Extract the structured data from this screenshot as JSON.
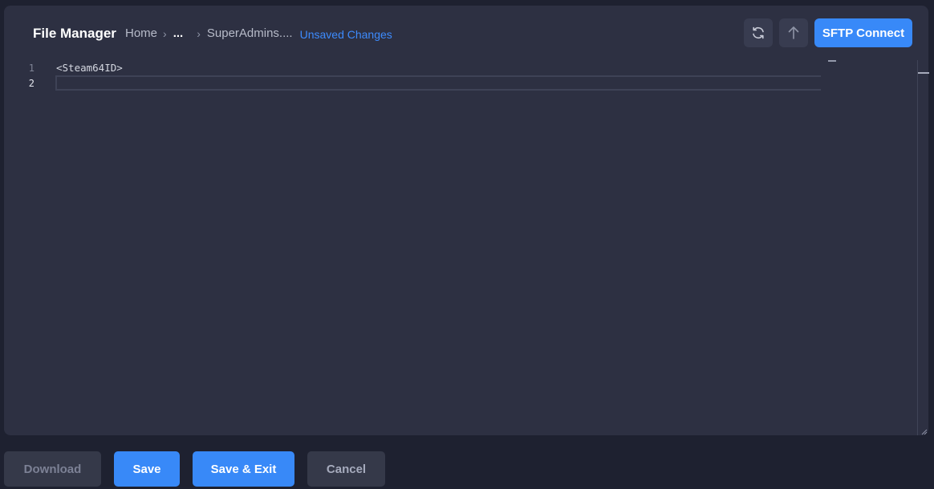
{
  "header": {
    "title": "File Manager",
    "breadcrumb": {
      "home": "Home",
      "ellipsis": "...",
      "file": "SuperAdmins....",
      "status": "Unsaved Changes"
    },
    "refresh_icon": "refresh-icon",
    "upload_icon": "arrow-up-icon",
    "sftp_label": "SFTP Connect"
  },
  "editor": {
    "lines": [
      {
        "number": "1",
        "text": "<Steam64ID>"
      },
      {
        "number": "2",
        "text": ""
      }
    ]
  },
  "footer": {
    "download_label": "Download",
    "save_label": "Save",
    "save_exit_label": "Save & Exit",
    "cancel_label": "Cancel"
  },
  "colors": {
    "accent": "#3889f8",
    "link": "#3d8bfd",
    "panel": "#2d3042",
    "background": "#1e2130"
  }
}
